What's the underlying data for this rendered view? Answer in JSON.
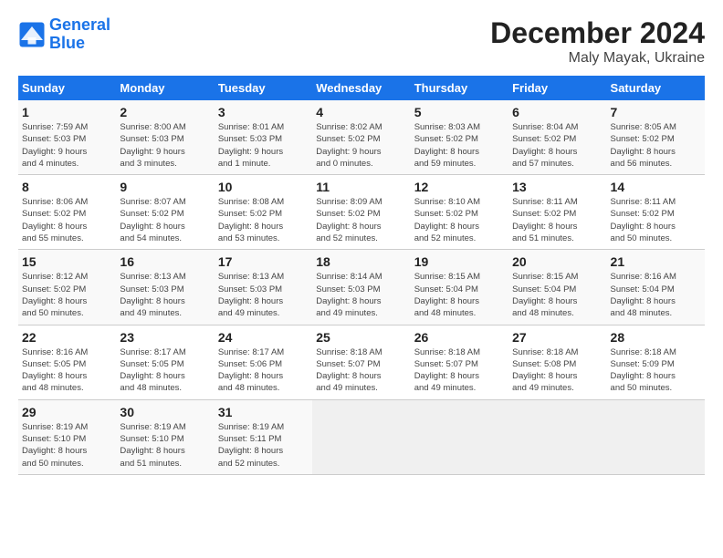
{
  "header": {
    "logo_line1": "General",
    "logo_line2": "Blue",
    "title": "December 2024",
    "subtitle": "Maly Mayak, Ukraine"
  },
  "days_of_week": [
    "Sunday",
    "Monday",
    "Tuesday",
    "Wednesday",
    "Thursday",
    "Friday",
    "Saturday"
  ],
  "weeks": [
    [
      {
        "day": "1",
        "detail": "Sunrise: 7:59 AM\nSunset: 5:03 PM\nDaylight: 9 hours\nand 4 minutes."
      },
      {
        "day": "2",
        "detail": "Sunrise: 8:00 AM\nSunset: 5:03 PM\nDaylight: 9 hours\nand 3 minutes."
      },
      {
        "day": "3",
        "detail": "Sunrise: 8:01 AM\nSunset: 5:03 PM\nDaylight: 9 hours\nand 1 minute."
      },
      {
        "day": "4",
        "detail": "Sunrise: 8:02 AM\nSunset: 5:02 PM\nDaylight: 9 hours\nand 0 minutes."
      },
      {
        "day": "5",
        "detail": "Sunrise: 8:03 AM\nSunset: 5:02 PM\nDaylight: 8 hours\nand 59 minutes."
      },
      {
        "day": "6",
        "detail": "Sunrise: 8:04 AM\nSunset: 5:02 PM\nDaylight: 8 hours\nand 57 minutes."
      },
      {
        "day": "7",
        "detail": "Sunrise: 8:05 AM\nSunset: 5:02 PM\nDaylight: 8 hours\nand 56 minutes."
      }
    ],
    [
      {
        "day": "8",
        "detail": "Sunrise: 8:06 AM\nSunset: 5:02 PM\nDaylight: 8 hours\nand 55 minutes."
      },
      {
        "day": "9",
        "detail": "Sunrise: 8:07 AM\nSunset: 5:02 PM\nDaylight: 8 hours\nand 54 minutes."
      },
      {
        "day": "10",
        "detail": "Sunrise: 8:08 AM\nSunset: 5:02 PM\nDaylight: 8 hours\nand 53 minutes."
      },
      {
        "day": "11",
        "detail": "Sunrise: 8:09 AM\nSunset: 5:02 PM\nDaylight: 8 hours\nand 52 minutes."
      },
      {
        "day": "12",
        "detail": "Sunrise: 8:10 AM\nSunset: 5:02 PM\nDaylight: 8 hours\nand 52 minutes."
      },
      {
        "day": "13",
        "detail": "Sunrise: 8:11 AM\nSunset: 5:02 PM\nDaylight: 8 hours\nand 51 minutes."
      },
      {
        "day": "14",
        "detail": "Sunrise: 8:11 AM\nSunset: 5:02 PM\nDaylight: 8 hours\nand 50 minutes."
      }
    ],
    [
      {
        "day": "15",
        "detail": "Sunrise: 8:12 AM\nSunset: 5:02 PM\nDaylight: 8 hours\nand 50 minutes."
      },
      {
        "day": "16",
        "detail": "Sunrise: 8:13 AM\nSunset: 5:03 PM\nDaylight: 8 hours\nand 49 minutes."
      },
      {
        "day": "17",
        "detail": "Sunrise: 8:13 AM\nSunset: 5:03 PM\nDaylight: 8 hours\nand 49 minutes."
      },
      {
        "day": "18",
        "detail": "Sunrise: 8:14 AM\nSunset: 5:03 PM\nDaylight: 8 hours\nand 49 minutes."
      },
      {
        "day": "19",
        "detail": "Sunrise: 8:15 AM\nSunset: 5:04 PM\nDaylight: 8 hours\nand 48 minutes."
      },
      {
        "day": "20",
        "detail": "Sunrise: 8:15 AM\nSunset: 5:04 PM\nDaylight: 8 hours\nand 48 minutes."
      },
      {
        "day": "21",
        "detail": "Sunrise: 8:16 AM\nSunset: 5:04 PM\nDaylight: 8 hours\nand 48 minutes."
      }
    ],
    [
      {
        "day": "22",
        "detail": "Sunrise: 8:16 AM\nSunset: 5:05 PM\nDaylight: 8 hours\nand 48 minutes."
      },
      {
        "day": "23",
        "detail": "Sunrise: 8:17 AM\nSunset: 5:05 PM\nDaylight: 8 hours\nand 48 minutes."
      },
      {
        "day": "24",
        "detail": "Sunrise: 8:17 AM\nSunset: 5:06 PM\nDaylight: 8 hours\nand 48 minutes."
      },
      {
        "day": "25",
        "detail": "Sunrise: 8:18 AM\nSunset: 5:07 PM\nDaylight: 8 hours\nand 49 minutes."
      },
      {
        "day": "26",
        "detail": "Sunrise: 8:18 AM\nSunset: 5:07 PM\nDaylight: 8 hours\nand 49 minutes."
      },
      {
        "day": "27",
        "detail": "Sunrise: 8:18 AM\nSunset: 5:08 PM\nDaylight: 8 hours\nand 49 minutes."
      },
      {
        "day": "28",
        "detail": "Sunrise: 8:18 AM\nSunset: 5:09 PM\nDaylight: 8 hours\nand 50 minutes."
      }
    ],
    [
      {
        "day": "29",
        "detail": "Sunrise: 8:19 AM\nSunset: 5:10 PM\nDaylight: 8 hours\nand 50 minutes."
      },
      {
        "day": "30",
        "detail": "Sunrise: 8:19 AM\nSunset: 5:10 PM\nDaylight: 8 hours\nand 51 minutes."
      },
      {
        "day": "31",
        "detail": "Sunrise: 8:19 AM\nSunset: 5:11 PM\nDaylight: 8 hours\nand 52 minutes."
      },
      null,
      null,
      null,
      null
    ]
  ]
}
